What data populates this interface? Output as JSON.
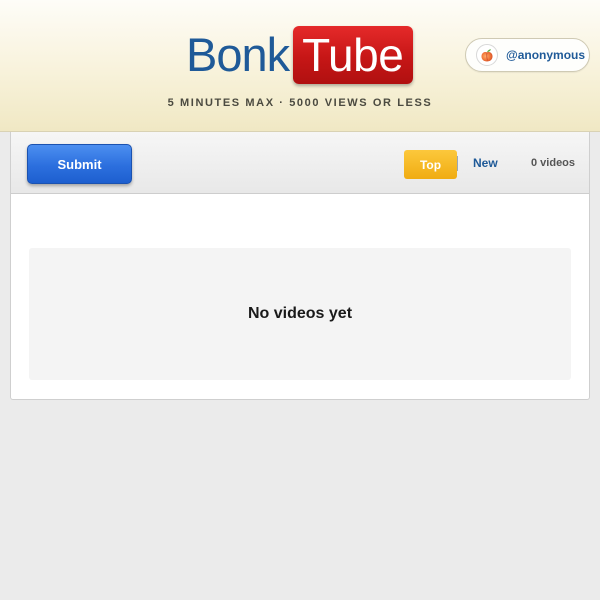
{
  "header": {
    "logo_left": "Bonk",
    "logo_right": "Tube",
    "tagline": "5 MINUTES MAX · 5000 VIEWS OR LESS",
    "user": {
      "avatar_icon": "peach-icon",
      "username": "@anonymous"
    }
  },
  "toolbar": {
    "submit_label": "Submit",
    "tabs": [
      {
        "label": "Top",
        "active": true
      },
      {
        "label": "New",
        "active": false
      }
    ],
    "video_count": "0 videos"
  },
  "main": {
    "empty_message": "No videos yet"
  },
  "colors": {
    "brand_blue": "#1f5a98",
    "brand_red": "#c61616",
    "active_tab": "#f0ac12",
    "submit_blue": "#2c6fde"
  }
}
